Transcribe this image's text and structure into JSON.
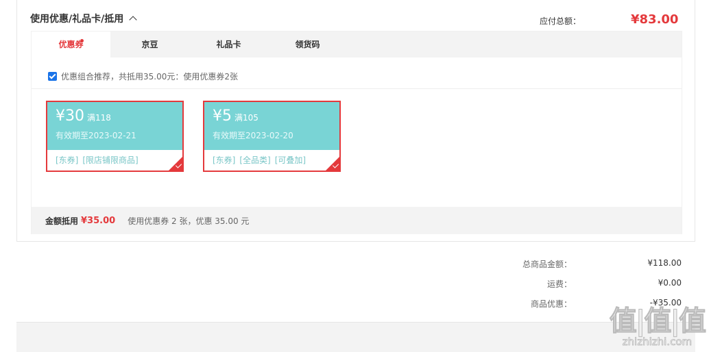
{
  "section": {
    "title": "使用优惠/礼品卡/抵用"
  },
  "tabs": [
    {
      "label": "优惠券",
      "active": true
    },
    {
      "label": "京豆",
      "active": false
    },
    {
      "label": "礼品卡",
      "active": false
    },
    {
      "label": "领货码",
      "active": false
    }
  ],
  "combo": {
    "text": "优惠组合推荐，共抵用35.00元：使用优惠券2张",
    "checked": true
  },
  "coupons": [
    {
      "amount": "¥30",
      "condition": "满118",
      "valid": "有效期至2023-02-21",
      "tags": [
        "[东券]",
        "[限店铺限商品]"
      ]
    },
    {
      "amount": "¥5",
      "condition": "满105",
      "valid": "有效期至2023-02-20",
      "tags": [
        "[东券]",
        "[全品类]",
        "[可叠加]"
      ]
    }
  ],
  "summary": {
    "label": "金额抵用",
    "amount": "¥35.00",
    "desc": "使用优惠券 2 张，优惠 35.00 元"
  },
  "totals": [
    {
      "label": "总商品金额：",
      "value": "¥118.00"
    },
    {
      "label": "运费：",
      "value": "¥0.00"
    },
    {
      "label": "商品优惠：",
      "value": "-¥35.00"
    }
  ],
  "payable": {
    "label": "应付总额：",
    "value": "¥83.00"
  },
  "watermark": {
    "big": "值|值|值",
    "small": "zhizhizhi.com"
  },
  "colors": {
    "accent": "#e4393c",
    "coupon_bg": "#79d4d5",
    "bar_bg": "#f3f3f3"
  }
}
